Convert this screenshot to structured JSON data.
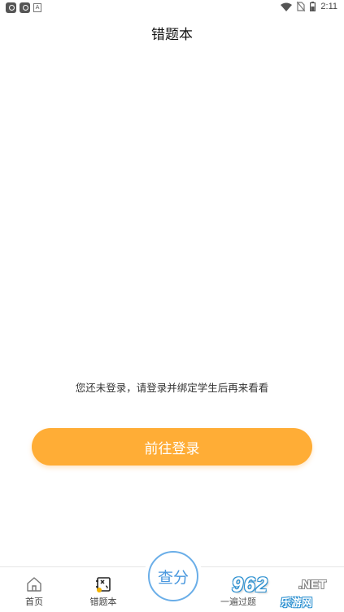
{
  "status_bar": {
    "time": "2:11",
    "left_icons": [
      "app-notification-icon",
      "app-notification-icon",
      "text-a-icon"
    ],
    "right_icons": [
      "wifi-icon",
      "no-sim-icon",
      "battery-icon"
    ]
  },
  "header": {
    "title": "错题本"
  },
  "main": {
    "message": "您还未登录，请登录并绑定学生后再来看看",
    "login_button": "前往登录"
  },
  "tab_bar": {
    "items": [
      {
        "label": "首页",
        "icon": "home-icon"
      },
      {
        "label": "错题本",
        "icon": "notebook-icon",
        "active": true
      },
      {
        "label": "一遍过题",
        "icon": ""
      }
    ],
    "center_button": "查分"
  },
  "watermark": {
    "number": "962",
    "suffix": ".NET",
    "text": "乐游网"
  },
  "colors": {
    "accent": "#ffad36",
    "center_blue": "#4a98de",
    "active_icon_dot": "#f5b400"
  }
}
